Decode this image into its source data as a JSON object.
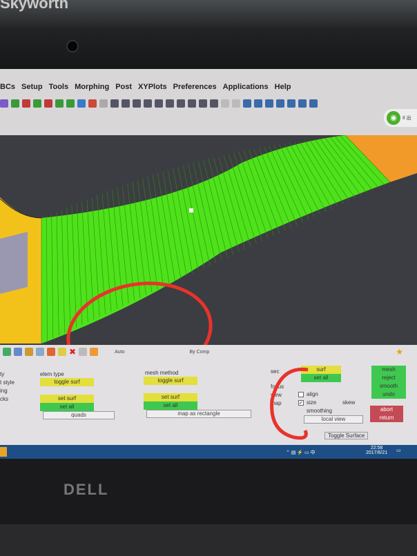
{
  "bezel": {
    "brand": "Skyworth",
    "logo": "DELL"
  },
  "menu": [
    "BCs",
    "Setup",
    "Tools",
    "Morphing",
    "Post",
    "XYPlots",
    "Preferences",
    "Applications",
    "Help"
  ],
  "wifi": {
    "icon": "wifi-icon",
    "text": "Il 出"
  },
  "toolbar2": {
    "auto": "Auto",
    "comp": "By Comp"
  },
  "panel": {
    "left_labels": [
      "ty",
      "t style",
      "ing",
      "cks"
    ],
    "col1": {
      "title": "elem type",
      "toggle": "toggle surf",
      "set_surf": "set surf",
      "set_all": "set all",
      "select": "quads"
    },
    "col2": {
      "title": "mesh method",
      "toggle": "toggle surf",
      "set_surf": "set surf",
      "set_all": "set all",
      "select": "map as rectangle"
    },
    "col3": {
      "sec": "sec",
      "surf": "surf",
      "set_all": "set all",
      "focus": "focus",
      "view": "view",
      "map": "map",
      "align": "align",
      "size": "size",
      "size_checked": true,
      "align_checked": false,
      "smoothing": "smoothing",
      "skew": "skew",
      "local_view": "local view"
    },
    "actions": {
      "mesh": "mesh",
      "reject": "reject",
      "smooth": "smooth",
      "undo": "undo",
      "abort": "abort",
      "return": "return"
    },
    "status": "Toggle Surface"
  },
  "taskbar": {
    "time": "22:58",
    "date": "2017/6/21"
  },
  "colors": {
    "mesh": "#4ee21a",
    "annotation": "#e8332a",
    "surface_orange": "#f19a2a",
    "surface_yellow": "#f3c21a"
  }
}
